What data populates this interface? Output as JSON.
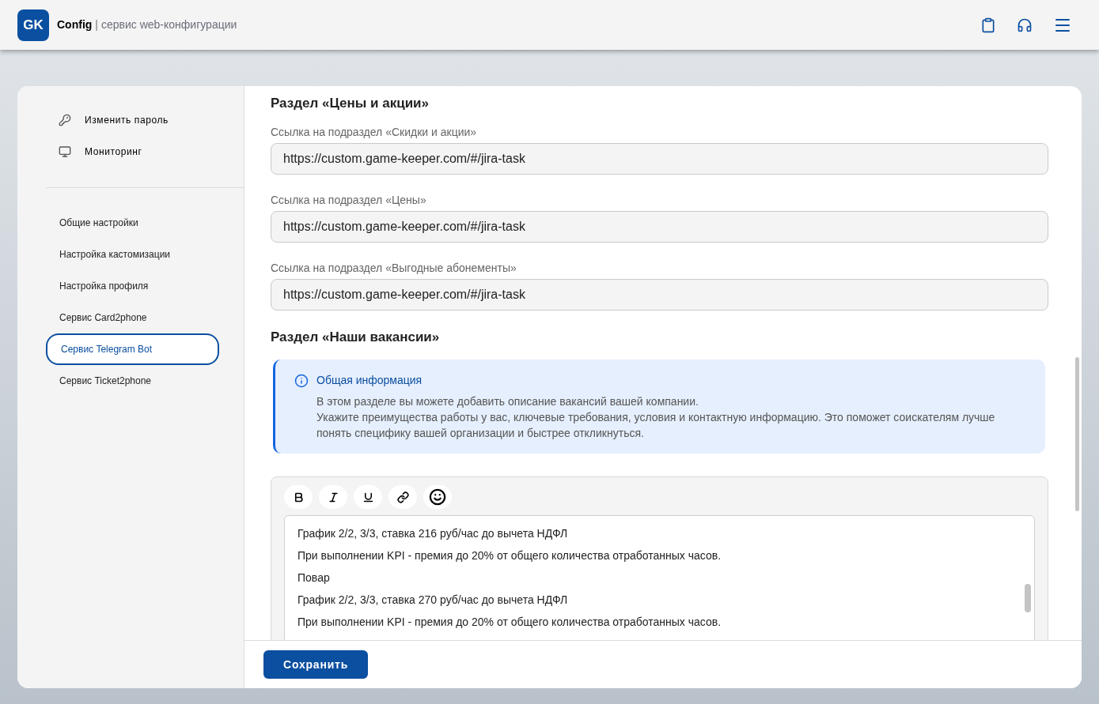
{
  "header": {
    "logo": "GK",
    "app_name": "Config",
    "separator": "|",
    "subtitle": "сервис web-конфигурации"
  },
  "sidebar": {
    "actions": [
      {
        "label": "Изменить пароль",
        "kind": "key"
      },
      {
        "label": "Мониторинг",
        "kind": "monitor"
      }
    ],
    "items": [
      {
        "label": "Общие настройки",
        "selected": false
      },
      {
        "label": "Настройка кастомизации",
        "selected": false
      },
      {
        "label": "Настройка профиля",
        "selected": false
      },
      {
        "label": "Сервис Card2phone",
        "selected": false
      },
      {
        "label": "Сервис Telegram Bot",
        "selected": true
      },
      {
        "label": "Сервис Ticket2phone",
        "selected": false
      }
    ]
  },
  "sections": [
    {
      "title": "Раздел «Цены и акции»",
      "fields": [
        {
          "label": "Ссылка на подраздел «Скидки и акции»",
          "value": "https://custom.game-keeper.com/#/jira-task"
        },
        {
          "label": "Ссылка на подраздел «Цены»",
          "value": "https://custom.game-keeper.com/#/jira-task"
        },
        {
          "label": "Ссылка на подраздел «Выгодные абонементы»",
          "value": "https://custom.game-keeper.com/#/jira-task"
        }
      ]
    },
    {
      "title": "Раздел «Наши вакансии»"
    }
  ],
  "info": {
    "title": "Общая информация",
    "lines": [
      "В этом разделе вы можете добавить описание вакансий вашей компании.",
      "Укажите преимущества работы у вас, ключевые требования, условия и контактную информацию. Это поможет соискателям лучше понять специфику вашей организации и быстрее откликнуться."
    ]
  },
  "editor": {
    "toolbar": [
      {
        "kind": "bold"
      },
      {
        "kind": "italic"
      },
      {
        "kind": "underline"
      },
      {
        "kind": "link"
      },
      {
        "kind": "emoji"
      }
    ],
    "lines": [
      "График 2/2, 3/3, ставка 216 руб/час до вычета НДФЛ",
      "При выполнении KPI - премия до 20% от общего количества отработанных часов.",
      "Повар",
      "График 2/2, 3/3, ставка 270 руб/час до вычета НДФЛ",
      "При выполнении KPI - премия до 20% от общего количества отработанных часов."
    ]
  },
  "save_button": "Сохранить"
}
